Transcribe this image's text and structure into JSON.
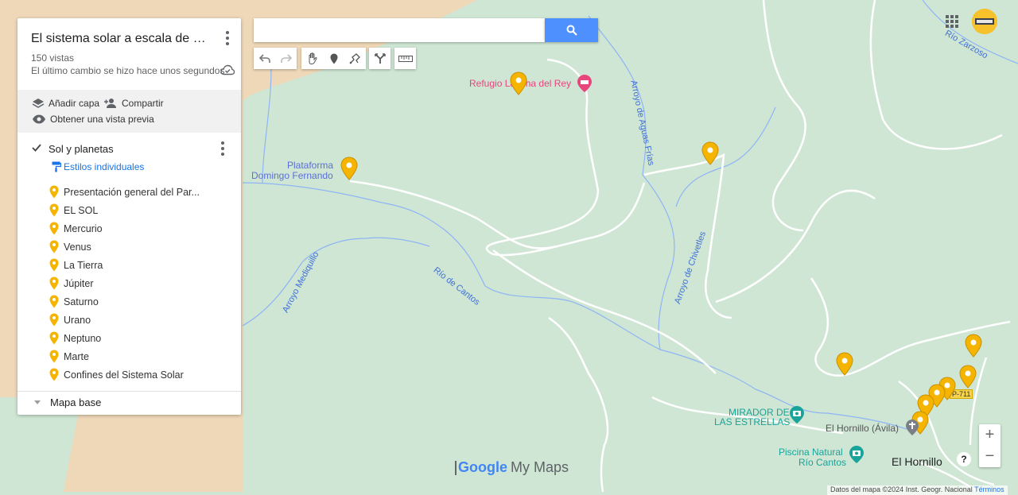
{
  "panel": {
    "title": "El sistema solar a escala de El H...",
    "views": "150 vistas",
    "last_change": "El último cambio se hizo hace unos segundos",
    "actions": {
      "add_layer": "Añadir capa",
      "share": "Compartir",
      "preview": "Obtener una vista previa"
    },
    "layer": {
      "title": "Sol y planetas",
      "checked": true,
      "style": "Estilos individuales",
      "items": [
        {
          "label": "Presentación general del Par...",
          "color": "#f4b400"
        },
        {
          "label": "EL SOL",
          "color": "#f4b400"
        },
        {
          "label": "Mercurio",
          "color": "#f4b400"
        },
        {
          "label": "Venus",
          "color": "#f4b400"
        },
        {
          "label": "La Tierra",
          "color": "#f4b400"
        },
        {
          "label": "Júpiter",
          "color": "#f4b400"
        },
        {
          "label": "Saturno",
          "color": "#f4b400"
        },
        {
          "label": "Urano",
          "color": "#f4b400"
        },
        {
          "label": "Neptuno",
          "color": "#f4b400"
        },
        {
          "label": "Marte",
          "color": "#f4b400"
        },
        {
          "label": "Confines del Sistema Solar",
          "color": "#f4b400"
        }
      ]
    },
    "base_map": "Mapa base"
  },
  "search": {
    "placeholder": "",
    "value": ""
  },
  "map": {
    "labels": {
      "refugio": "Refugio Lancha del Rey",
      "plataforma_1": "Plataforma",
      "plataforma_2": "Domingo Fernando",
      "mirador_1": "MIRADOR DE",
      "mirador_2": "LAS ESTRELLAS",
      "hornillo_avila": "El Hornillo (Ávila)",
      "piscina_1": "Piscina Natural",
      "piscina_2": "Río Cantos",
      "hornillo": "El Hornillo",
      "rio_cantos": "Río de Cantos",
      "arroyo_mediquillo": "Arroyo Mediquillo",
      "arroyo_aguas_frias": "Arroyo de Aguas Frías",
      "arroyo_chivetles": "Arroyo de Chivetles",
      "rio_zarzoso": "Río Zarzoso",
      "road_code": "P-711"
    },
    "colors": {
      "land": "#cfe6d4",
      "sand": "#eed8b8",
      "water": "#7fa9f0",
      "pin": "#f4b400",
      "poi_red": "#e8457c",
      "poi_teal": "#1aa39a"
    },
    "logo": "Google",
    "logo_suffix": "My Maps",
    "attribution": "Datos del mapa ©2024 Inst. Geogr. Nacional",
    "terms": "Términos"
  }
}
